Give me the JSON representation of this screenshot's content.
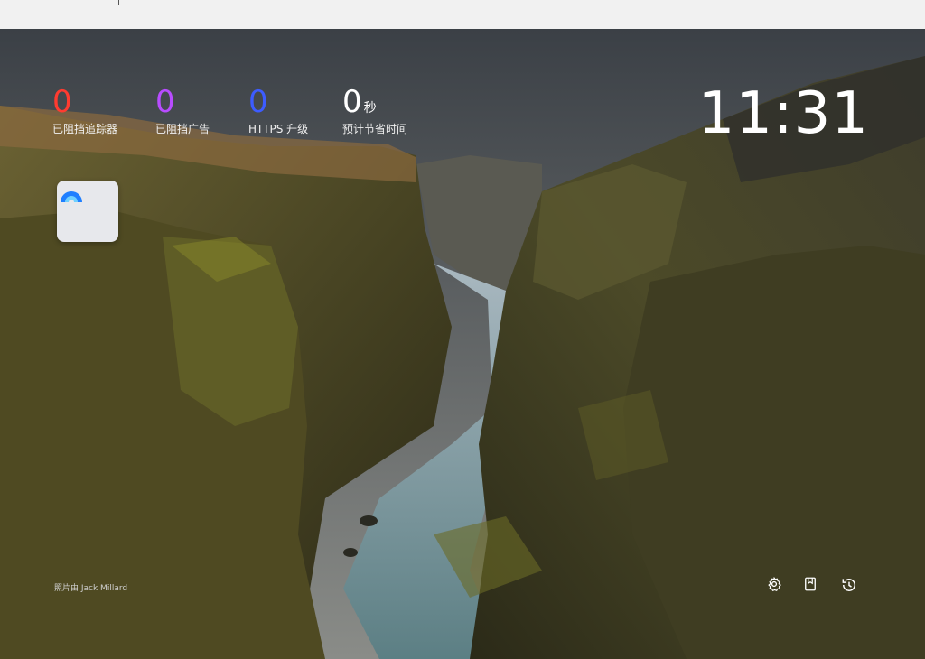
{
  "stats": {
    "trackers": {
      "value": "0",
      "label": "已阻挡追踪器",
      "color": "#ff3b30"
    },
    "ads": {
      "value": "0",
      "label": "已阻挡广告",
      "color": "#b84cff"
    },
    "https": {
      "value": "0",
      "label": "HTTPS 升级",
      "color": "#3d5cff"
    },
    "time": {
      "value": "0",
      "unit": "秒",
      "label": "预计节省时间",
      "color": "#ffffff"
    }
  },
  "clock": {
    "time": "11:31"
  },
  "top_site": {
    "icon": "globe-tile-icon"
  },
  "photo_credit": "照片由 Jack Millard",
  "bottom_icons": {
    "settings": "gear-icon",
    "bookmarks": "bookmark-icon",
    "history": "history-icon"
  }
}
